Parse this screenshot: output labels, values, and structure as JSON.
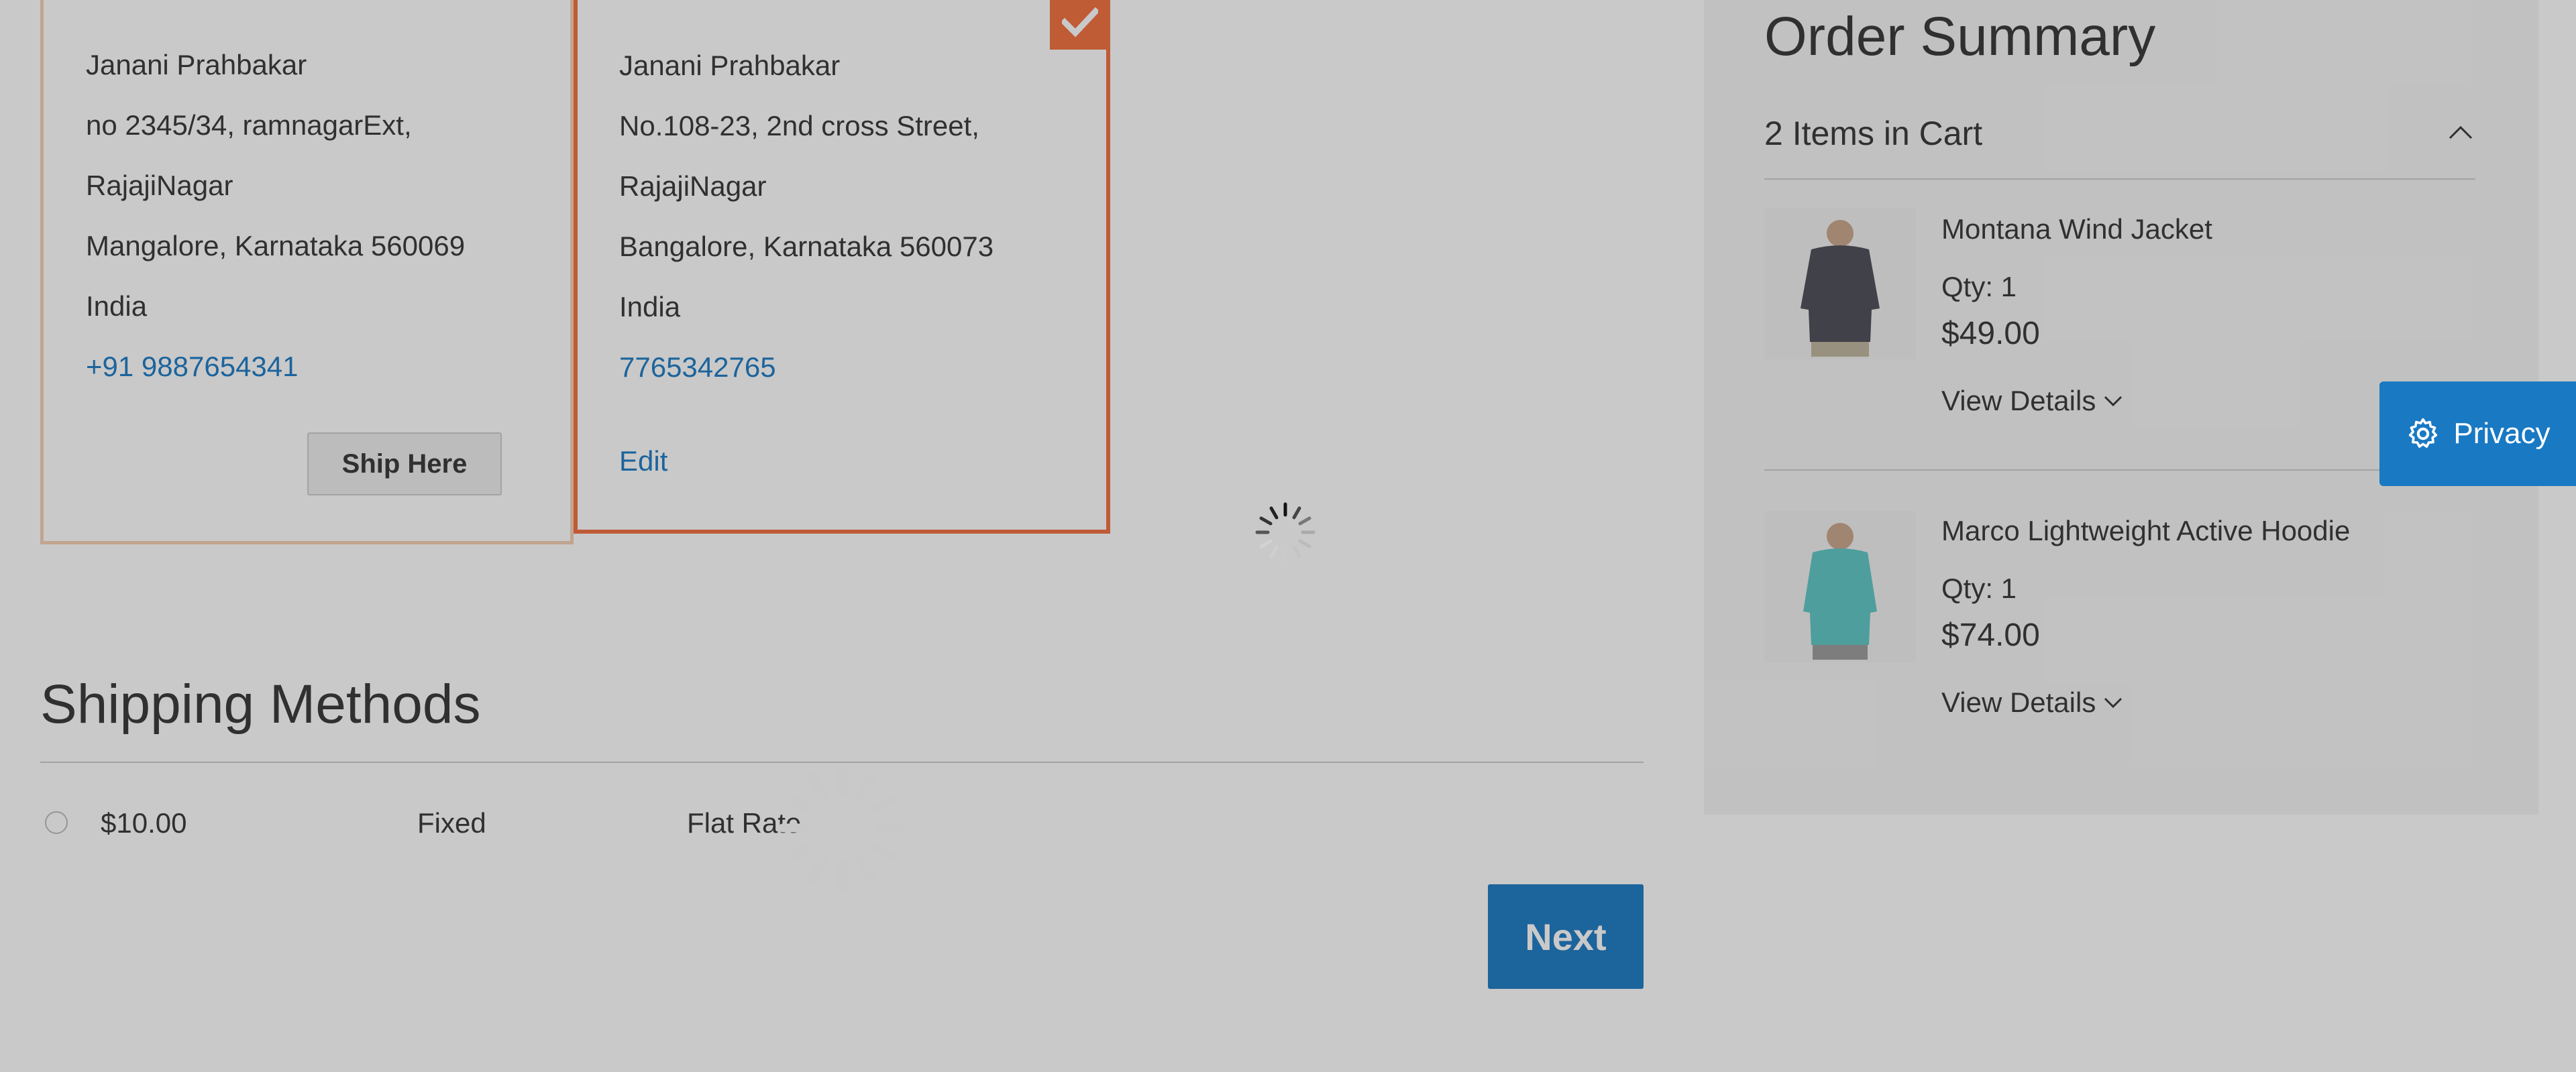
{
  "addresses": [
    {
      "name": "Janani Prahbakar",
      "street": "no 2345/34, ramnagarExt,",
      "area": "RajajiNagar",
      "city_line": "Mangalore, Karnataka 560069",
      "country": "India",
      "phone": "+91 9887654341",
      "button_label": "Ship Here"
    },
    {
      "name": "Janani Prahbakar",
      "street": "No.108-23, 2nd cross Street,",
      "area": "RajajiNagar",
      "city_line": "Bangalore, Karnataka 560073",
      "country": "India",
      "phone": "7765342765",
      "edit_label": "Edit",
      "selected": true
    }
  ],
  "shipping": {
    "title": "Shipping Methods",
    "method": {
      "price": "$10.00",
      "method_title": "Fixed",
      "carrier_title": "Flat Rate"
    },
    "next_label": "Next"
  },
  "summary": {
    "title": "Order Summary",
    "cart_count": "2 Items in Cart",
    "items": [
      {
        "name": "Montana Wind Jacket",
        "qty": "Qty: 1",
        "price": "$49.00",
        "details_label": "View Details",
        "thumb_color": "#4a4a55"
      },
      {
        "name": "Marco Lightweight Active Hoodie",
        "qty": "Qty: 1",
        "price": "$74.00",
        "details_label": "View Details",
        "thumb_color": "#5bc6c4"
      }
    ]
  },
  "privacy": {
    "label": "Privacy"
  },
  "colors": {
    "accent": "#f26d3a",
    "link": "#1979c3",
    "button": "#1979c3",
    "panel": "#f5f5f5"
  }
}
